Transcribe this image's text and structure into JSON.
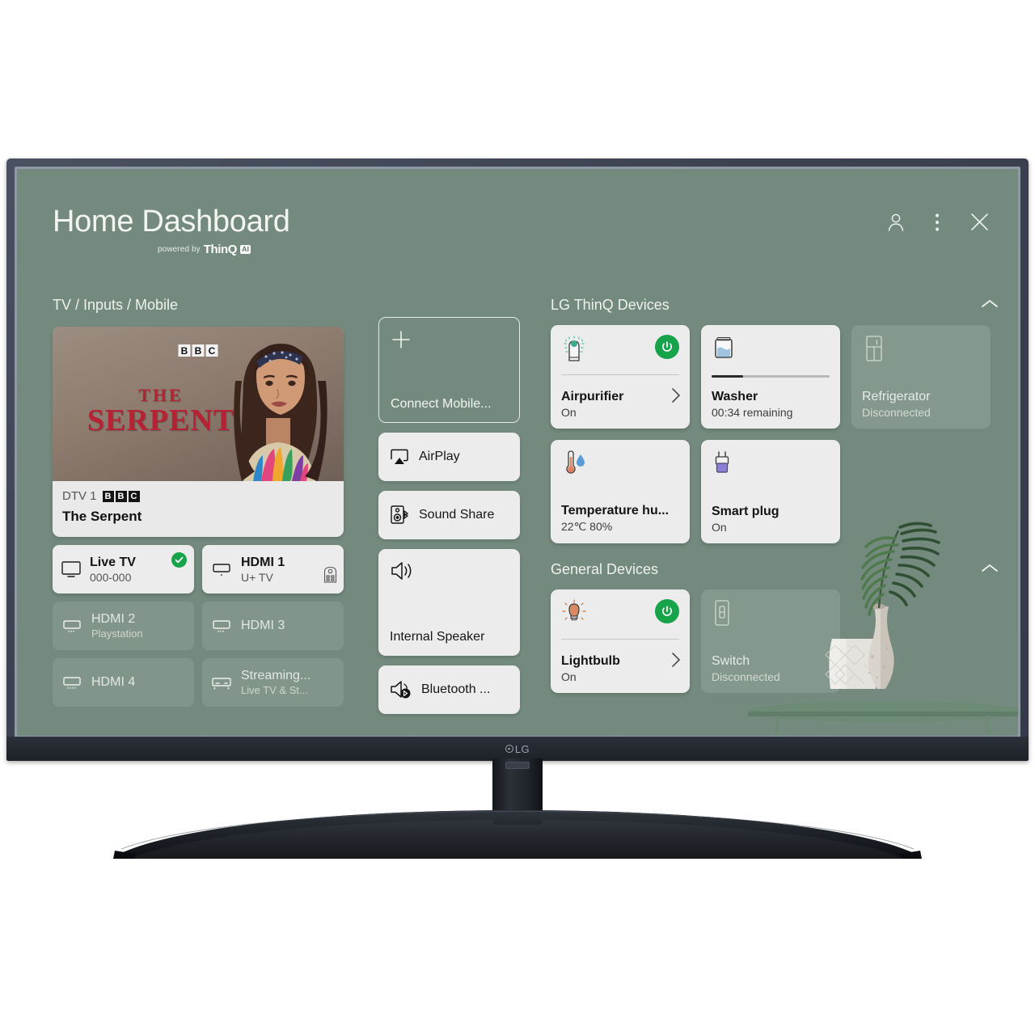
{
  "app": {
    "title": "Home Dashboard",
    "powered_by": "powered by",
    "brand": "ThinQ",
    "brand_badge": "AI",
    "brand_logo": "LG"
  },
  "header": {
    "actions": [
      {
        "name": "profile-icon",
        "label": "Profile"
      },
      {
        "name": "more-options-icon",
        "label": "More options"
      },
      {
        "name": "close-icon",
        "label": "Close"
      }
    ]
  },
  "colors": {
    "background": "#748a7e",
    "card": "#ececec",
    "card_dim": "rgba(255,255,255,0.12)",
    "accent_green": "#16a34a",
    "bezel": "#3c4250"
  },
  "left_column": {
    "title": "TV / Inputs / Mobile",
    "preview": {
      "channel_prefix": "DTV 1",
      "channel_logo_letters": [
        "B",
        "B",
        "C"
      ],
      "programme": "The Serpent",
      "art_logo_letters": [
        "B",
        "B",
        "C"
      ],
      "art_title_line1": "THE",
      "art_title_line2": "SERPENT"
    },
    "inputs": [
      {
        "name": "live-tv",
        "label": "Live TV",
        "sub": "000-000",
        "state": "active",
        "icon": "monitor-icon",
        "badge": "check"
      },
      {
        "name": "hdmi-1",
        "label": "HDMI 1",
        "sub": "U+ TV",
        "state": "active",
        "icon": "hdmi-icon",
        "badge": "remote"
      },
      {
        "name": "hdmi-2",
        "label": "HDMI 2",
        "sub": "Playstation",
        "state": "dim",
        "icon": "hdmi-icon",
        "badge": ""
      },
      {
        "name": "hdmi-3",
        "label": "HDMI 3",
        "sub": "",
        "state": "dim",
        "icon": "hdmi-icon",
        "badge": ""
      },
      {
        "name": "hdmi-4",
        "label": "HDMI 4",
        "sub": "",
        "state": "dim",
        "icon": "hdmi-icon",
        "badge": ""
      },
      {
        "name": "streaming",
        "label": "Streaming...",
        "sub": "Live TV & St...",
        "state": "dim",
        "icon": "set-top-box-icon",
        "badge": ""
      }
    ]
  },
  "mid_column": {
    "connect_mobile": {
      "label": "Connect Mobile...",
      "icon": "plus-icon"
    },
    "buttons": [
      {
        "name": "airplay",
        "label": "AirPlay",
        "icon": "airplay-icon",
        "tall": false
      },
      {
        "name": "sound-share",
        "label": "Sound Share",
        "icon": "sound-share-icon",
        "tall": false
      },
      {
        "name": "internal-speaker",
        "label": "Internal Speaker",
        "icon": "speaker-icon",
        "tall": true
      },
      {
        "name": "bluetooth-device",
        "label": "Bluetooth ...",
        "icon": "bluetooth-speaker-icon",
        "tall": false
      }
    ]
  },
  "right_column": {
    "thinq": {
      "title": "LG ThinQ Devices",
      "collapse_icon": "chevron-up-icon",
      "devices": [
        {
          "name": "airpurifier",
          "label": "Airpurifier",
          "state": "On",
          "status": "on",
          "icon": "air-purifier-icon",
          "power": true,
          "chevron": true,
          "progress": null
        },
        {
          "name": "washer",
          "label": "Washer",
          "state": "00:34 remaining",
          "status": "on",
          "icon": "washer-icon",
          "power": false,
          "chevron": false,
          "progress": 27
        },
        {
          "name": "refrigerator",
          "label": "Refrigerator",
          "state": "Disconnected",
          "status": "off",
          "icon": "refrigerator-icon",
          "power": false,
          "chevron": false,
          "progress": null
        },
        {
          "name": "temperature-humidity",
          "label": "Temperature hu...",
          "state": "22℃ 80%",
          "status": "on",
          "icon": "thermometer-icon",
          "power": false,
          "chevron": false,
          "progress": null
        },
        {
          "name": "smart-plug",
          "label": "Smart plug",
          "state": "On",
          "status": "on",
          "icon": "plug-icon",
          "power": false,
          "chevron": false,
          "progress": null
        }
      ]
    },
    "general": {
      "title": "General Devices",
      "collapse_icon": "chevron-up-icon",
      "devices": [
        {
          "name": "lightbulb",
          "label": "Lightbulb",
          "state": "On",
          "status": "on",
          "icon": "lightbulb-icon",
          "power": true,
          "chevron": true
        },
        {
          "name": "switch",
          "label": "Switch",
          "state": "Disconnected",
          "status": "off",
          "icon": "switch-icon",
          "power": false,
          "chevron": false
        }
      ]
    }
  }
}
